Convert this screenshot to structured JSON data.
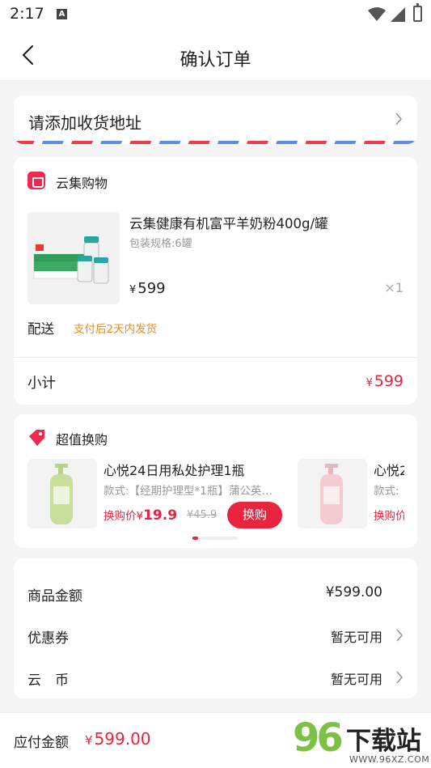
{
  "status_bar": {
    "time": "2:17",
    "notification_icon": "A"
  },
  "header": {
    "title": "确认订单"
  },
  "address": {
    "placeholder": "请添加收货地址"
  },
  "order": {
    "shop_name": "云集购物",
    "product": {
      "name": "云集健康有机富平羊奶粉400g/罐",
      "spec": "包装规格:6罐",
      "currency": "¥",
      "price": "599",
      "quantity": "×1"
    },
    "delivery_label": "配送",
    "delivery_value": "支付后2天内发货",
    "subtotal_label": "小计",
    "subtotal_currency": "¥",
    "subtotal_value": "599"
  },
  "exchange": {
    "title": "超值换购",
    "items": [
      {
        "name": "心悦24日用私处护理1瓶",
        "spec": "款式:【经期护理型*1瓶】蒲公英…",
        "price_label": "换购价",
        "currency": "¥",
        "price": "19.9",
        "original": "¥45.9",
        "button": "换购"
      },
      {
        "name": "心悦2",
        "spec": "款式:",
        "price_label": "换购价"
      }
    ]
  },
  "summary": {
    "goods_label": "商品金额",
    "goods_value": "¥599.00",
    "coupon_label": "优惠券",
    "coupon_value": "暂无可用",
    "coin_label": "云　币",
    "coin_value": "暂无可用"
  },
  "footer": {
    "pay_label": "应付金额",
    "currency": "¥",
    "pay_value": "599.00"
  },
  "watermark": {
    "number": "96",
    "text": "下载站",
    "url": "WWW.96XZ.COM"
  },
  "colors": {
    "accent": "#e8243f",
    "orange": "#f08b1e",
    "background": "#f5f5f5"
  }
}
